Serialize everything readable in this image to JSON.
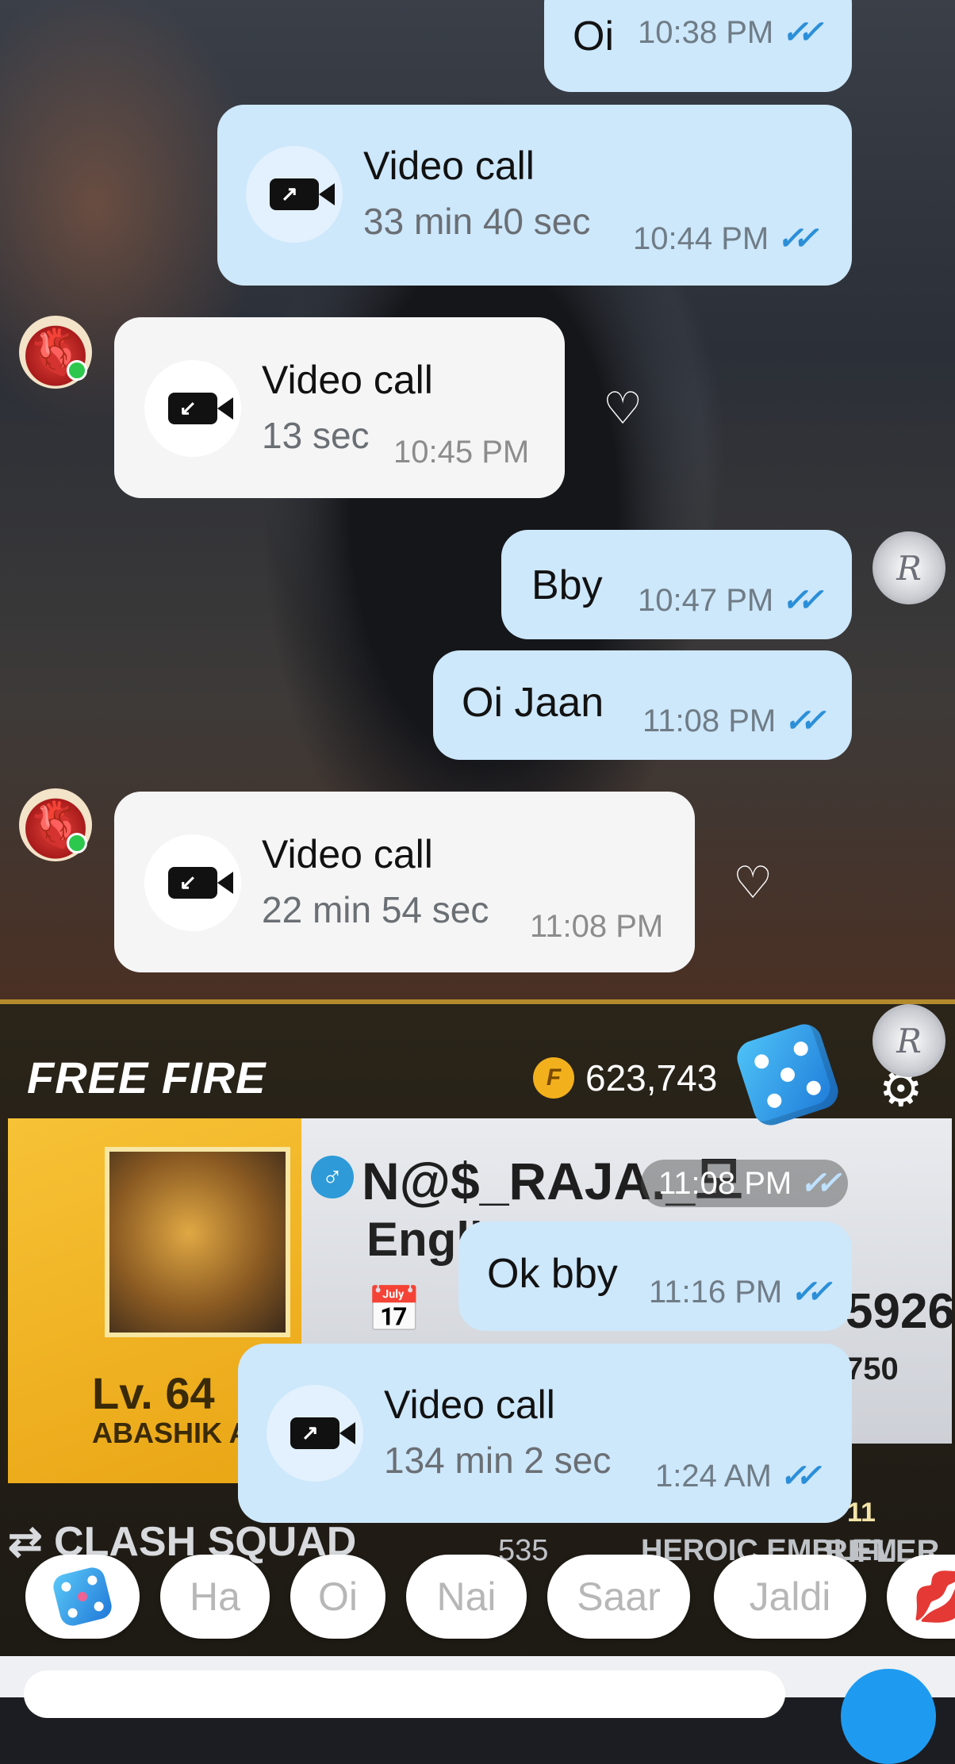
{
  "wallpaper": {
    "game_logo": "FREE FIRE",
    "coins": "623,743",
    "coin_symbol": "F",
    "player_name": "N@$_RAJA._모",
    "language": "Engli",
    "player_id_fragment": "5926",
    "small_stat": "750",
    "level": "Lv. 64",
    "title": "ABASHIK AR",
    "mode": "⇄ CLASH SQUAD",
    "stat_535": "535",
    "emblem": "HEROIC EMBLEM",
    "rank_number": "11",
    "role": "RIFLER"
  },
  "messages": [
    {
      "type": "text",
      "direction": "out",
      "text": "Oi",
      "time": "10:38 PM"
    },
    {
      "type": "call",
      "direction": "out",
      "title": "Video call",
      "duration": "33 min 40 sec",
      "time": "10:44 PM"
    },
    {
      "type": "call",
      "direction": "in",
      "title": "Video call",
      "duration": "13 sec",
      "time": "10:45 PM"
    },
    {
      "type": "text",
      "direction": "out",
      "text": "Bby",
      "time": "10:47 PM"
    },
    {
      "type": "text",
      "direction": "out",
      "text": "Oi Jaan",
      "time": "11:08 PM"
    },
    {
      "type": "call",
      "direction": "in",
      "title": "Video call",
      "duration": "22 min 54 sec",
      "time": "11:08 PM"
    },
    {
      "type": "sticker",
      "direction": "out",
      "time": "11:08 PM"
    },
    {
      "type": "text",
      "direction": "out",
      "text": "Ok bby",
      "time": "11:16 PM"
    },
    {
      "type": "call",
      "direction": "out",
      "title": "Video call",
      "duration": "134 min  2 sec",
      "time": "1:24 AM"
    }
  ],
  "read_ticks": "✓✓",
  "quick_replies": [
    "Ha",
    "Oi",
    "Nai",
    "Saar",
    "Jaldi"
  ],
  "colors": {
    "outgoing_bubble": "#cde7fb",
    "incoming_bubble": "#f5f5f6",
    "read_tick": "#2b8fd8",
    "send_button": "#1e9bf0"
  }
}
